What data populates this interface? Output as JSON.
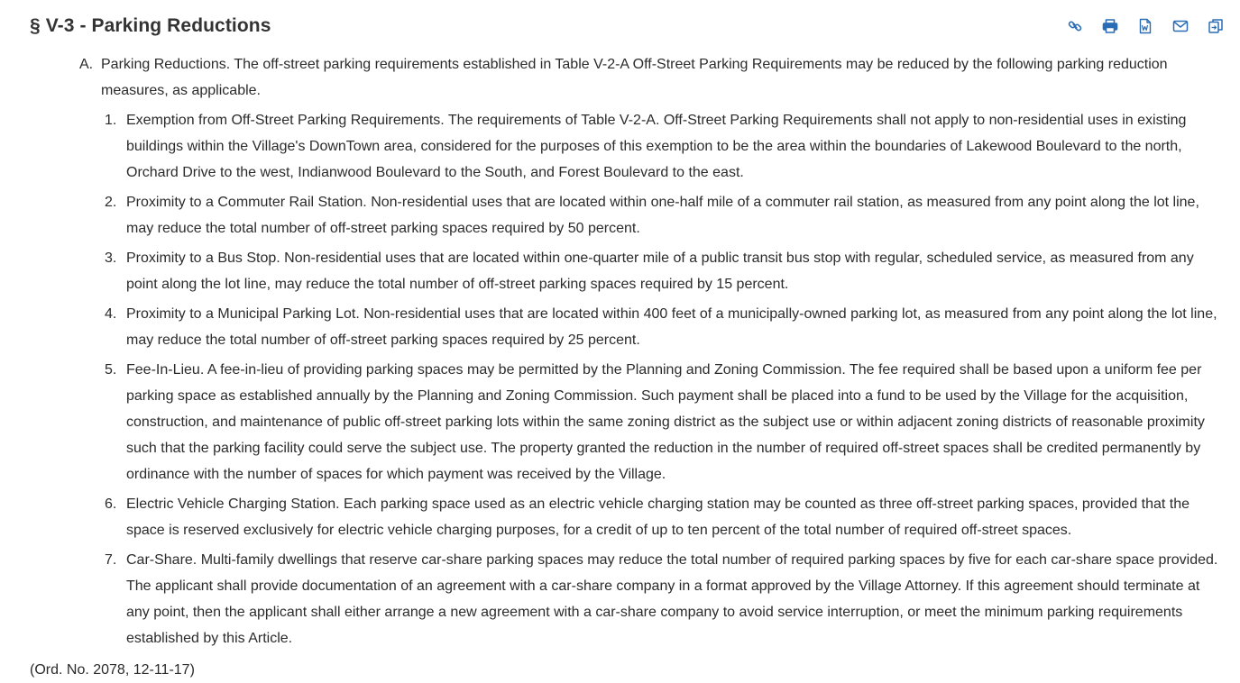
{
  "header": {
    "title": "§ V-3 - Parking Reductions",
    "accent_color": "#2a6db5"
  },
  "toolbar": {
    "icons": [
      "link-icon",
      "print-icon",
      "word-document-icon",
      "email-icon",
      "copy-icon"
    ]
  },
  "section": {
    "subsection": {
      "marker": "A.",
      "text": "Parking Reductions. The off-street parking requirements established in Table V-2-A Off-Street Parking Requirements may be reduced by the following parking reduction measures, as applicable."
    },
    "items": [
      {
        "marker": "1.",
        "text": "Exemption from Off-Street Parking Requirements. The requirements of Table V-2-A. Off-Street Parking Requirements shall not apply to non-residential uses in existing buildings within the Village's DownTown area, considered for the purposes of this exemption to be the area within the boundaries of Lakewood Boulevard to the north, Orchard Drive to the west, Indianwood Boulevard to the South, and Forest Boulevard to the east."
      },
      {
        "marker": "2.",
        "text": "Proximity to a Commuter Rail Station. Non-residential uses that are located within one-half mile of a commuter rail station, as measured from any point along the lot line, may reduce the total number of off-street parking spaces required by 50 percent."
      },
      {
        "marker": "3.",
        "text": "Proximity to a Bus Stop. Non-residential uses that are located within one-quarter mile of a public transit bus stop with regular, scheduled service, as measured from any point along the lot line, may reduce the total number of off-street parking spaces required by 15 percent."
      },
      {
        "marker": "4.",
        "text": "Proximity to a Municipal Parking Lot. Non-residential uses that are located within 400 feet of a municipally-owned parking lot, as measured from any point along the lot line, may reduce the total number of off-street parking spaces required by 25 percent."
      },
      {
        "marker": "5.",
        "text": "Fee-In-Lieu. A fee-in-lieu of providing parking spaces may be permitted by the Planning and Zoning Commission. The fee required shall be based upon a uniform fee per parking space as established annually by the Planning and Zoning Commission. Such payment shall be placed into a fund to be used by the Village for the acquisition, construction, and maintenance of public off-street parking lots within the same zoning district as the subject use or within adjacent zoning districts of reasonable proximity such that the parking facility could serve the subject use. The property granted the reduction in the number of required off-street spaces shall be credited permanently by ordinance with the number of spaces for which payment was received by the Village."
      },
      {
        "marker": "6.",
        "text": "Electric Vehicle Charging Station. Each parking space used as an electric vehicle charging station may be counted as three off-street parking spaces, provided that the space is reserved exclusively for electric vehicle charging purposes, for a credit of up to ten percent of the total number of required off-street spaces."
      },
      {
        "marker": "7.",
        "text": "Car-Share. Multi-family dwellings that reserve car-share parking spaces may reduce the total number of required parking spaces by five for each car-share space provided. The applicant shall provide documentation of an agreement with a car-share company in a format approved by the Village Attorney. If this agreement should terminate at any point, then the applicant shall either arrange a new agreement with a car-share company to avoid service interruption, or meet the minimum parking requirements established by this Article."
      }
    ]
  },
  "history_note": "(Ord. No. 2078, 12-11-17)"
}
